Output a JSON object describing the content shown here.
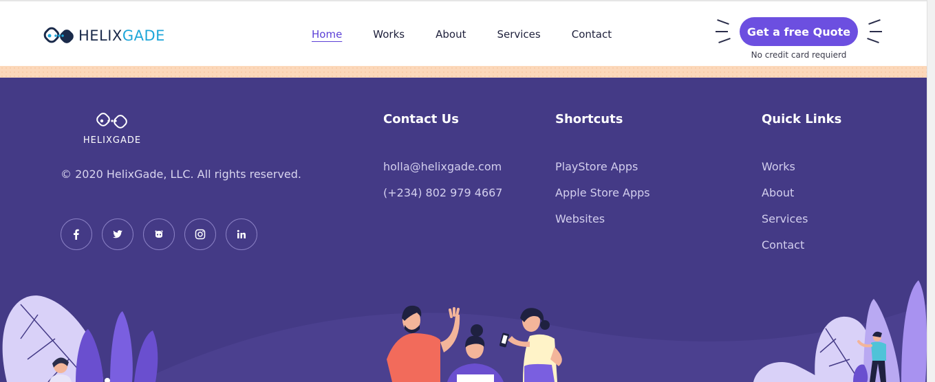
{
  "header": {
    "logo": {
      "part1": "HELIX",
      "part2": "GADE"
    },
    "nav": [
      {
        "label": "Home",
        "active": true
      },
      {
        "label": "Works",
        "active": false
      },
      {
        "label": "About",
        "active": false
      },
      {
        "label": "Services",
        "active": false
      },
      {
        "label": "Contact",
        "active": false
      }
    ],
    "cta_label": "Get a free Quote",
    "cta_note": "No credit card requierd"
  },
  "footer": {
    "logo_text": "HELIXGADE",
    "copyright": "© 2020 HelixGade, LLC. All rights reserved.",
    "socials": [
      "facebook-icon",
      "twitter-icon",
      "github-icon",
      "instagram-icon",
      "linkedin-icon"
    ],
    "contact": {
      "title": "Contact Us",
      "items": [
        "holla@helixgade.com",
        "(+234) 802 979 4667"
      ]
    },
    "shortcuts": {
      "title": "Shortcuts",
      "items": [
        "PlayStore Apps",
        "Apple Store Apps",
        "Websites"
      ]
    },
    "quick_links": {
      "title": "Quick Links",
      "items": [
        "Works",
        "About",
        "Services",
        "Contact"
      ]
    }
  },
  "colors": {
    "accent": "#6c4fe0",
    "footer_bg": "#443a86",
    "peach": "#fcd8ba",
    "logo_blue": "#1ea6d9"
  }
}
